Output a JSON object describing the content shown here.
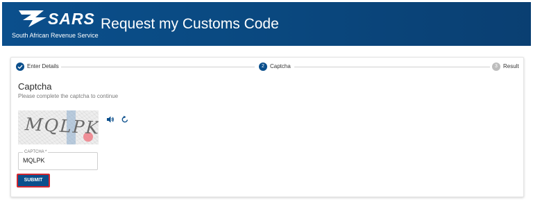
{
  "header": {
    "logo_text": "SARS",
    "logo_sub": "South African Revenue Service",
    "title": "Request my Customs Code"
  },
  "stepper": {
    "steps": [
      {
        "label": "Enter Details",
        "status": "complete",
        "number": "1"
      },
      {
        "label": "Captcha",
        "status": "active",
        "number": "2"
      },
      {
        "label": "Result",
        "status": "inactive",
        "number": "3"
      }
    ]
  },
  "captcha": {
    "title": "Captcha",
    "subtitle": "Please complete the captcha to continue",
    "image_text": "MQLPK",
    "audio_icon": "speaker-icon",
    "refresh_icon": "refresh-icon"
  },
  "form": {
    "captcha_label": "CAPTCHA *",
    "captcha_value": "MQLPK",
    "submit_label": "SUBMIT"
  },
  "colors": {
    "brand": "#0b4f8c",
    "highlight": "#d3262e",
    "inactive": "#bdbdbd"
  }
}
